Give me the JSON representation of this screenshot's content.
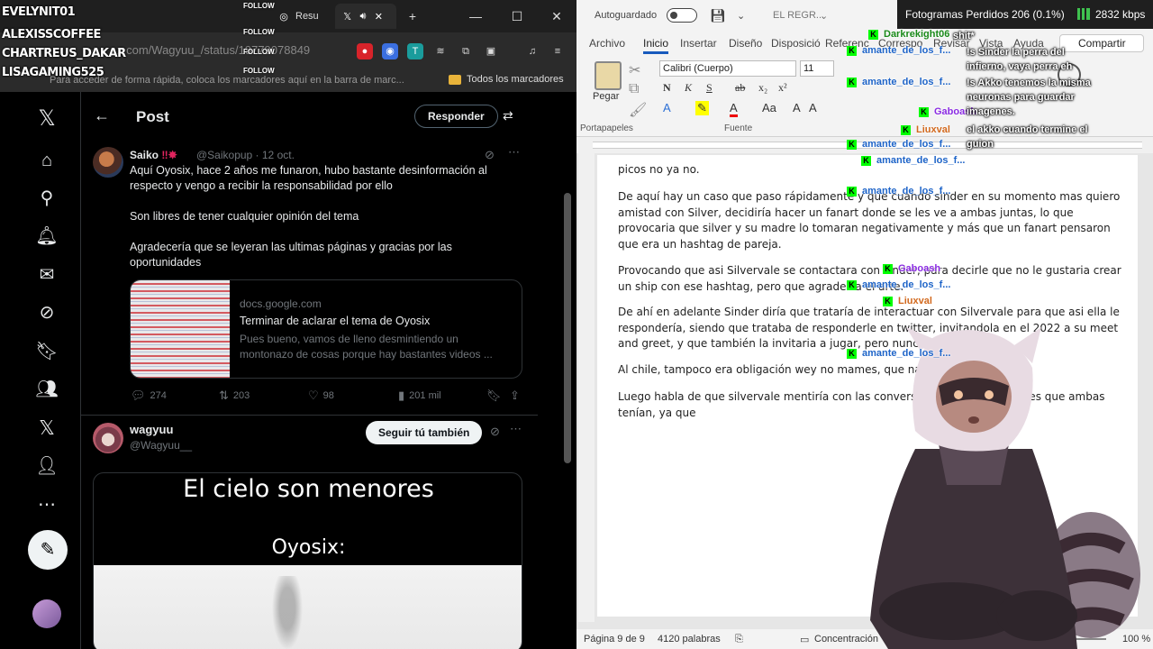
{
  "overlay_names": {
    "names": [
      "EVELYNIT01",
      "ALEXISSCOFFEE",
      "CHARTREUS_DAKAR",
      "LISAGAMING525"
    ],
    "follow": "FOLLOW"
  },
  "browser": {
    "tabs": [
      {
        "label": "Resu"
      },
      {
        "label": ""
      }
    ],
    "url": "x.com/Wagyuu_/status/19779078849",
    "bookmarks_hint": "Para acceder de forma rápida, coloca los marcadores aquí en la barra de marc...",
    "bookmarks_all": "Todos los marcadores"
  },
  "x": {
    "header": {
      "title": "Post",
      "reply": "Responder"
    },
    "tweet1": {
      "name": "Saiko",
      "handle": "@Saikopup · 12 oct.",
      "p1": "Aquí Oyosix, hace 2 años me funaron, hubo bastante desinformación al respecto y vengo a recibir la responsabilidad por ello",
      "p2": "Son libres de tener cualquier opinión del tema",
      "p3": "Agradecería que se leyeran las ultimas páginas y gracias por las oportunidades",
      "card": {
        "domain": "docs.google.com",
        "title": "Terminar de aclarar el tema de Oyosix",
        "desc": "Pues bueno, vamos de lleno desmintiendo un montonazo de cosas porque hay bastantes videos ..."
      },
      "stats": {
        "replies": "274",
        "reposts": "203",
        "likes": "98",
        "views": "201 mil"
      }
    },
    "tweet2": {
      "name": "wagyuu",
      "handle": "@Wagyuu__",
      "follow": "Seguir tú también",
      "meme_line1": "El cielo son menores",
      "meme_line2": "Oyosix:"
    }
  },
  "word": {
    "autosave": "Autoguardado",
    "doc_name": "EL REGR...",
    "tabs": [
      "Archivo",
      "Inicio",
      "Insertar",
      "Diseño",
      "Disposició",
      "Referenc",
      "Correspo",
      "Revisar",
      "Vista",
      "Ayuda"
    ],
    "share": "Compartir",
    "paste": "Pegar",
    "clipboard": "Portapapeles",
    "font_name": "Calibri (Cuerpo)",
    "font_size": "11",
    "font_group": "Fuente",
    "paragraphs": [
      "picos no ya no.",
      "De aquí hay un caso que paso rápidamente y que cuando sinder en su momento mas quiero amistad con Silver, decidiría hacer un fanart donde se les ve a ambas juntas, lo que provocaria que silver y su madre lo tomaran negativamente y más que un fanart pensaron que era un hashtag de pareja.",
      "Provocando que asi Silvervale se contactara con sinder, para decirle que no le gustaria crear un ship con ese hashtag, pero que agradecia el arte.",
      "De ahí en adelante Sinder diría que trataría de interactuar con Silvervale para que asi ella le respondería, siendo que trataba de responderle en twitter, invitandola en el 2022 a su meet and greet, y que también la invitaria a jugar, pero nunca le respondió.",
      "Al chile, tampoco era obligación wey no mames, que nacada.",
      "Luego habla de que silvervale mentiría con las conversaciones y los mensajes que ambas tenían, ya que"
    ],
    "status": {
      "page": "Página 9 de 9",
      "words": "4120 palabras",
      "focus": "Concentración",
      "zoom": "100 %"
    }
  },
  "obs": {
    "frames": "Fotogramas Perdidos 206 (0.1%)",
    "kbps": "2832 kbps"
  },
  "chat": {
    "users": [
      {
        "name": "Darkrekight06",
        "color": "#1a8a1a"
      },
      {
        "name": "amante_de_los_f...",
        "color": "#1e64c8"
      },
      {
        "name": "amante_de_los_f...",
        "color": "#1e64c8"
      },
      {
        "name": "Gaboash",
        "color": "#8a2be2"
      },
      {
        "name": "Liuxval",
        "color": "#d2691e"
      },
      {
        "name": "amante_de_los_f...",
        "color": "#1e64c8"
      },
      {
        "name": "amante_de_los_f...",
        "color": "#1e64c8"
      },
      {
        "name": "amante_de_los_f...",
        "color": "#1e64c8"
      },
      {
        "name": "Gaboash",
        "color": "#8a2be2"
      },
      {
        "name": "amante_de_los_f...",
        "color": "#1e64c8"
      },
      {
        "name": "Liuxval",
        "color": "#d2691e"
      },
      {
        "name": "amante_de_los_f...",
        "color": "#1e64c8"
      }
    ],
    "messages": [
      "shit*",
      "!s Sinder la perra del infierno, vaya perra eh",
      "!s Akko tenemos la misma neuronas para guardar imagenes.",
      "el akko cuando termine el guion"
    ]
  }
}
